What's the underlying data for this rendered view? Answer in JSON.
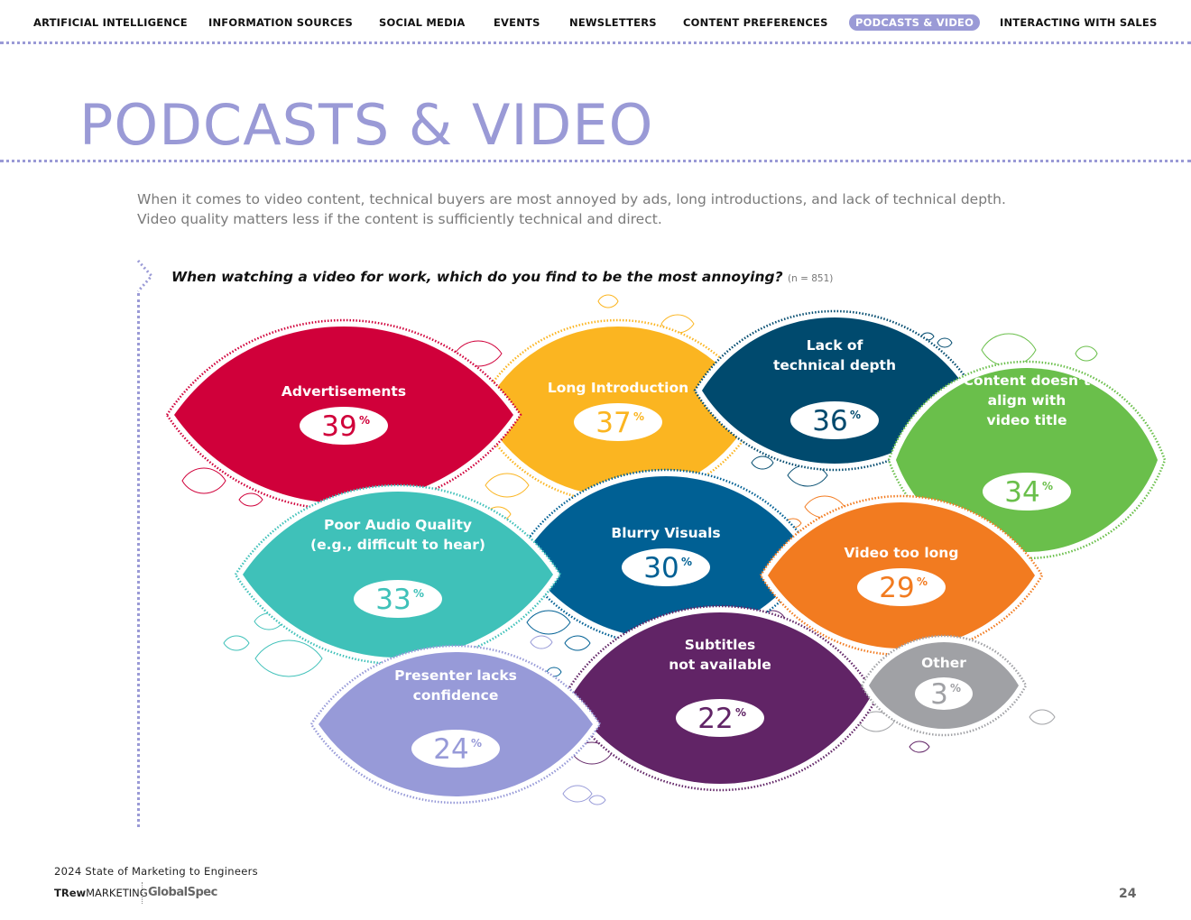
{
  "nav": {
    "items": [
      {
        "label": "ARTIFICIAL INTELLIGENCE",
        "active": false
      },
      {
        "label": "INFORMATION SOURCES",
        "active": false
      },
      {
        "label": "SOCIAL MEDIA",
        "active": false
      },
      {
        "label": "EVENTS",
        "active": false
      },
      {
        "label": "NEWSLETTERS",
        "active": false
      },
      {
        "label": "CONTENT PREFERENCES",
        "active": false
      },
      {
        "label": "PODCASTS & VIDEO",
        "active": true
      },
      {
        "label": "INTERACTING WITH SALES",
        "active": false
      }
    ]
  },
  "page": {
    "title": "PODCASTS & VIDEO",
    "intro": [
      "When it comes to video content, technical buyers are most annoyed by ads, long introductions, and lack of technical depth.",
      "Video quality matters less if the content is sufficiently technical and direct."
    ],
    "question": "When watching a video for work, which do you find to be the most annoying?",
    "sample": "(n = 851)"
  },
  "chart_data": {
    "type": "bubble-infographic",
    "unit": "%",
    "items": [
      {
        "label_lines": [
          "Advertisements"
        ],
        "value": 39,
        "color": "#d0003a"
      },
      {
        "label_lines": [
          "Long Introduction"
        ],
        "value": 37,
        "color": "#fbb521"
      },
      {
        "label_lines": [
          "Lack of",
          "technical depth"
        ],
        "value": 36,
        "color": "#004a6e"
      },
      {
        "label_lines": [
          "Content doesn’t",
          "align with",
          "video title"
        ],
        "value": 34,
        "color": "#6abf4b"
      },
      {
        "label_lines": [
          "Poor Audio Quality",
          "(e.g., difficult to hear)"
        ],
        "value": 33,
        "color": "#3fc1b9"
      },
      {
        "label_lines": [
          "Blurry Visuals"
        ],
        "value": 30,
        "color": "#006094"
      },
      {
        "label_lines": [
          "Video too long"
        ],
        "value": 29,
        "color": "#f27b20"
      },
      {
        "label_lines": [
          "Presenter lacks",
          "confidence"
        ],
        "value": 24,
        "color": "#979ad8"
      },
      {
        "label_lines": [
          "Subtitles",
          "not available"
        ],
        "value": 22,
        "color": "#612466"
      },
      {
        "label_lines": [
          "Other"
        ],
        "value": 3,
        "color": "#a0a1a5"
      }
    ]
  },
  "footer": {
    "report": "2024 State of Marketing to Engineers",
    "logo_trew_bold": "TRew",
    "logo_trew": "MARKETING",
    "logo_globalspec": "GlobalSpec",
    "page_number": "24"
  },
  "colors": {
    "accent": "#9a9ad6"
  }
}
